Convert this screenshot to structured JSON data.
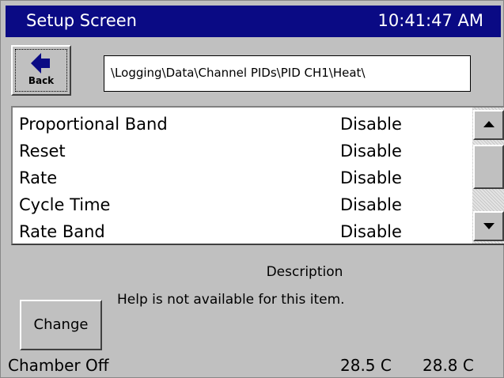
{
  "window": {
    "title": "Setup Screen",
    "clock": "10:41:47 AM",
    "title_bar_color": "#0a0a84"
  },
  "toolbar": {
    "back_label": "Back",
    "back_icon": "left-arrow-icon"
  },
  "path": "\\Logging\\Data\\Channel PIDs\\PID CH1\\Heat\\",
  "settings": {
    "rows": [
      {
        "name": "Proportional Band",
        "value": "Disable"
      },
      {
        "name": "Reset",
        "value": "Disable"
      },
      {
        "name": "Rate",
        "value": "Disable"
      },
      {
        "name": "Cycle Time",
        "value": "Disable"
      },
      {
        "name": "Rate Band",
        "value": "Disable"
      }
    ],
    "scroll_up_icon": "triangle-up-icon",
    "scroll_down_icon": "triangle-down-icon"
  },
  "description": {
    "header": "Description",
    "text": "Help is not available for this item."
  },
  "actions": {
    "change_label": "Change"
  },
  "status": {
    "chamber": "Chamber Off",
    "temp1": "28.5 C",
    "temp2": "28.8 C"
  }
}
